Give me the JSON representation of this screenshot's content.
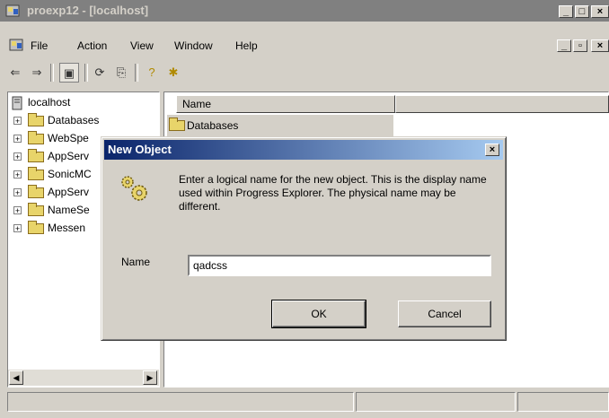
{
  "window": {
    "title": "proexp12 - [localhost]"
  },
  "menu": {
    "items": [
      "File",
      "Action",
      "View",
      "Window",
      "Help"
    ]
  },
  "toolbar": {
    "icons": [
      "back-arrow-icon",
      "forward-arrow-icon",
      "show-hide-tree-icon",
      "refresh-icon",
      "export-list-icon",
      "help-icon",
      "new-object-icon"
    ]
  },
  "tree": {
    "root": "localhost",
    "items": [
      "Databases",
      "WebSpe",
      "AppServ",
      "SonicMC",
      "AppServ",
      "NameSe",
      "Messen"
    ]
  },
  "list": {
    "column_name": "Name",
    "rows": [
      "Databases"
    ]
  },
  "dialog": {
    "title": "New Object",
    "message": "Enter a logical name for the new object.  This is the display name used within Progress Explorer.  The physical name may be different.",
    "name_label": "Name",
    "name_value": "qadcss",
    "ok_label": "OK",
    "cancel_label": "Cancel"
  }
}
